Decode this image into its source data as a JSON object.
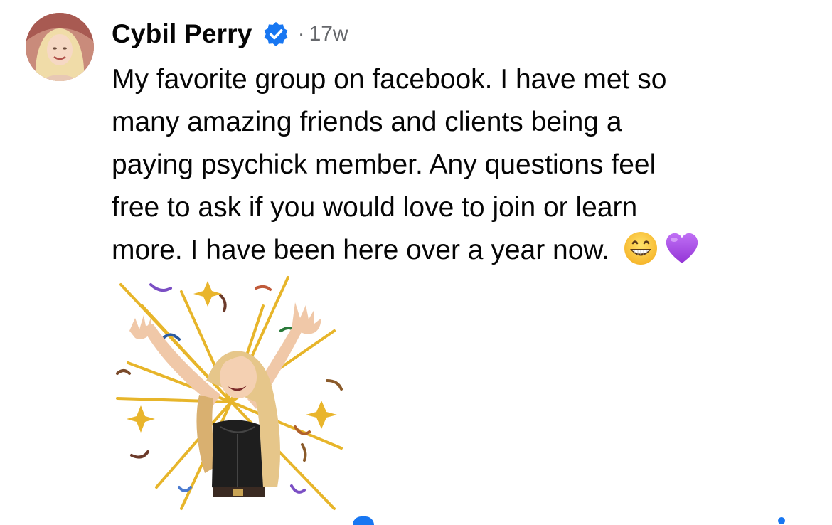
{
  "comment": {
    "author": "Cybil Perry",
    "verified_icon": "verified-badge-icon",
    "separator": "·",
    "time": "17w",
    "text_lines": [
      "My favorite group on facebook. I have met so",
      "many amazing friends and clients being a",
      "paying psychick member. Any questions feel",
      "free to ask if you would love to join or learn",
      "more. I have been here over a year now."
    ],
    "emojis": [
      "grinning-face-emoji",
      "purple-heart-emoji"
    ],
    "sticker": "celebration-sticker"
  },
  "colors": {
    "verified_blue": "#1877f2",
    "meta_gray": "#65676b",
    "text": "#050505",
    "purple_heart": "#a24bde",
    "confetti_gold": "#e7b52a"
  }
}
